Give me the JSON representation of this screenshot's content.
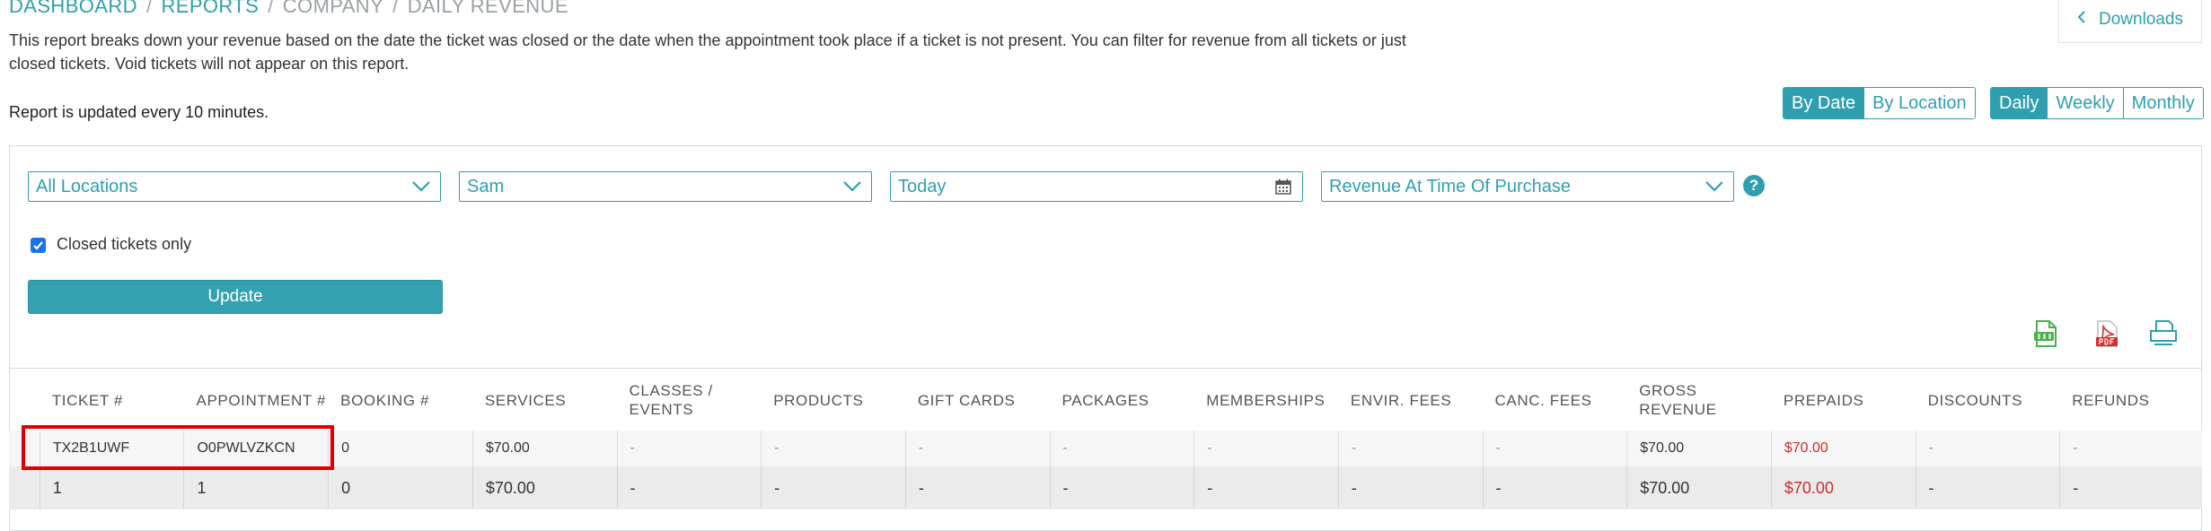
{
  "breadcrumb": {
    "items": [
      "DASHBOARD",
      "REPORTS",
      "COMPANY",
      "DAILY REVENUE"
    ],
    "separator": "/"
  },
  "description": "This report breaks down your revenue based on the date the ticket was closed or the date when the appointment took place if a ticket is not present. You can filter for revenue from all tickets or just closed tickets. Void tickets will not appear on this report.",
  "update_note": "Report is updated every 10 minutes.",
  "downloads": {
    "label": "Downloads",
    "icon": "chevron-left-icon"
  },
  "view_toggle": {
    "options": [
      "By Date",
      "By Location"
    ],
    "selected": "By Date"
  },
  "period_toggle": {
    "options": [
      "Daily",
      "Weekly",
      "Monthly"
    ],
    "selected": "Daily"
  },
  "filters": {
    "location": "All Locations",
    "staff": "Sam",
    "date": "Today",
    "revenue_type": "Revenue At Time Of Purchase",
    "help": "?"
  },
  "closed_only": {
    "label": "Closed tickets only",
    "checked": true
  },
  "update_button": "Update",
  "export_icons": [
    "csv-icon",
    "pdf-icon",
    "print-icon"
  ],
  "table": {
    "columns": [
      "TICKET #",
      "APPOINTMENT #",
      "BOOKING #",
      "SERVICES",
      "CLASSES / EVENTS",
      "PRODUCTS",
      "GIFT CARDS",
      "PACKAGES",
      "MEMBERSHIPS",
      "ENVIR. FEES",
      "CANC. FEES",
      "GROSS REVENUE",
      "PREPAIDS",
      "DISCOUNTS",
      "REFUNDS"
    ],
    "rows": [
      [
        "TX2B1UWF",
        "O0PWLVZKCN",
        "0",
        "$70.00",
        "-",
        "-",
        "-",
        "-",
        "-",
        "-",
        "-",
        "$70.00",
        "$70.00",
        "-",
        "-"
      ]
    ],
    "totals": [
      "1",
      "1",
      "0",
      "$70.00",
      "-",
      "-",
      "-",
      "-",
      "-",
      "-",
      "-",
      "$70.00",
      "$70.00",
      "-",
      "-"
    ]
  },
  "colors": {
    "accent": "#2f9fb0",
    "negative": "#c9302c",
    "highlight": "#e00000"
  }
}
